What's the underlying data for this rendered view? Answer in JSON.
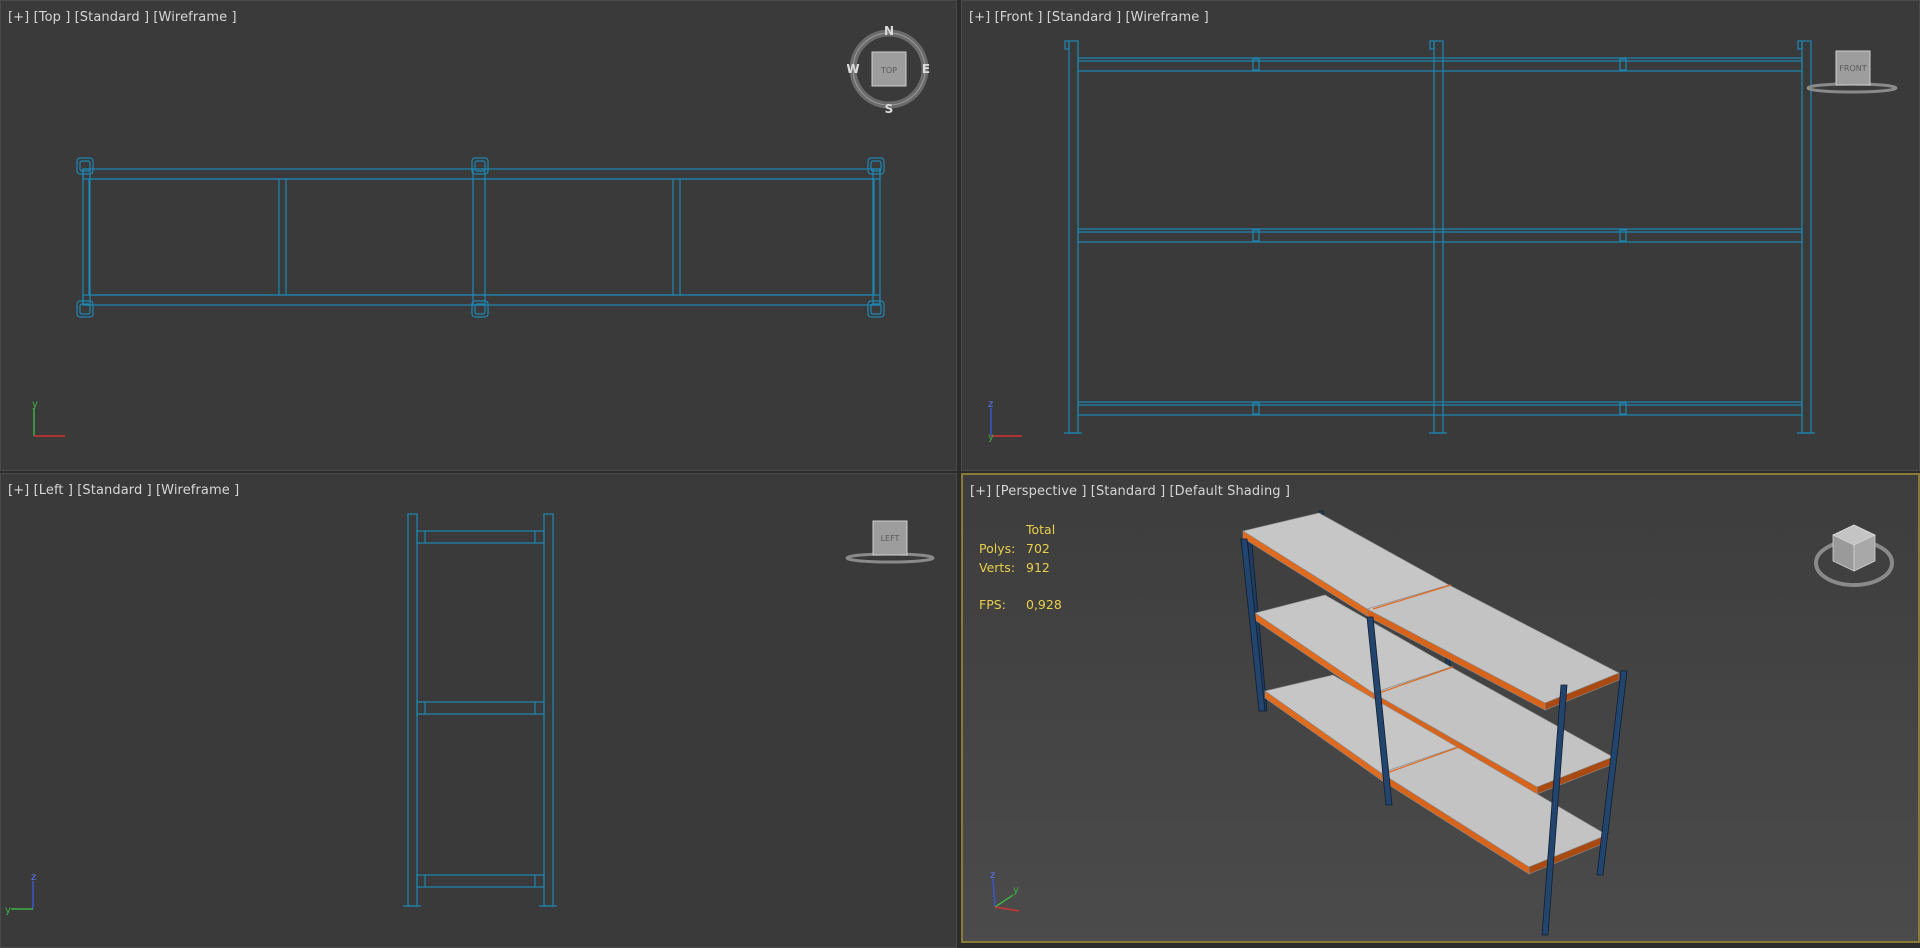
{
  "viewports": {
    "top": {
      "label": "[+] [Top ] [Standard ] [Wireframe ]",
      "cube_label": "TOP",
      "compass": {
        "n": "N",
        "e": "E",
        "s": "S",
        "w": "W"
      },
      "axes": {
        "a": "y",
        "b": "x"
      }
    },
    "front": {
      "label": "[+] [Front ] [Standard ] [Wireframe ]",
      "cube_label": "FRONT",
      "axes": {
        "a": "z",
        "b": "y"
      }
    },
    "left": {
      "label": "[+] [Left ] [Standard ] [Wireframe ]",
      "cube_label": "LEFT",
      "axes": {
        "a": "z",
        "b": "y"
      }
    },
    "perspective": {
      "label": "[+] [Perspective ] [Standard ] [Default Shading ]",
      "axes": {
        "a": "z",
        "b": "y"
      }
    }
  },
  "stats": {
    "header": "Total",
    "polys_label": "Polys:",
    "polys": "702",
    "verts_label": "Verts:",
    "verts": "912",
    "fps_label": "FPS:",
    "fps": "0,928"
  },
  "colors": {
    "wireframe": "#1e87b4",
    "shelf_top": "#c8c8c8",
    "shelf_edge": "#e06a1e",
    "post": "#1f3b5e",
    "stats_text": "#e8d04a",
    "active_border": "#8a7a3a"
  }
}
